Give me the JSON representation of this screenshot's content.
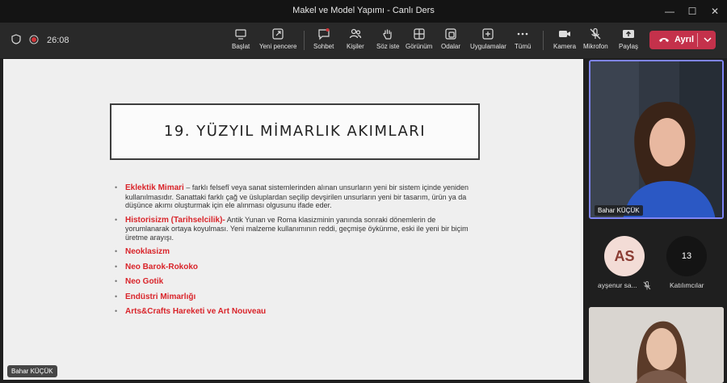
{
  "window": {
    "title": "Makel ve Model Yapımı - Canlı Ders"
  },
  "meeting": {
    "timer": "26:08"
  },
  "toolbar": {
    "start": "Başlat",
    "new_window": "Yeni pencere",
    "chat": "Sohbet",
    "people": "Kişiler",
    "raise_hand": "Söz iste",
    "view": "Görünüm",
    "rooms": "Odalar",
    "apps": "Uygulamalar",
    "more": "Tümü",
    "camera": "Kamera",
    "mic": "Mikrofon",
    "share": "Paylaş",
    "leave": "Ayrıl"
  },
  "slide": {
    "title": "19. YÜZYIL MİMARLIK AKIMLARI",
    "bullets": [
      {
        "term": "Eklektik Mimari",
        "text": " – farklı felsefî veya sanat sistemlerinden alınan unsurların yeni bir sistem içinde yeniden kullanılmasıdır. Sanattaki farklı çağ ve üsluplardan seçilip devşirilen unsurların yeni bir tasarım, ürün ya da düşünce akımı oluşturmak için ele alınması olgusunu ifade eder."
      },
      {
        "term": "Historisizm (Tarihselcilik)-",
        "text": " Antik Yunan ve Roma klasizminin yanında sonraki dönemlerin de yorumlanarak ortaya koyulması. Yeni malzeme kullanımının reddi, geçmişe öykünme, eski ile yeni bir biçim üretme arayışı."
      },
      {
        "term": "Neoklasizm",
        "text": ""
      },
      {
        "term": "Neo Barok-Rokoko",
        "text": ""
      },
      {
        "term": "Neo Gotik",
        "text": ""
      },
      {
        "term": "Endüstri Mimarlığı",
        "text": ""
      },
      {
        "term": "Arts&Crafts Hareketi ve Art Nouveau",
        "text": ""
      }
    ]
  },
  "presenter": {
    "name": "Bahar KÜÇÜK"
  },
  "participants": {
    "video_name": "Bahar KÜÇÜK",
    "avatar_initials": "AS",
    "avatar_name": "ayşenur sa...",
    "count": "13",
    "count_label": "Katılımcılar"
  },
  "colors": {
    "leave": "#c4314b",
    "accent": "#7f85f5",
    "slide_red": "#d9242a"
  }
}
